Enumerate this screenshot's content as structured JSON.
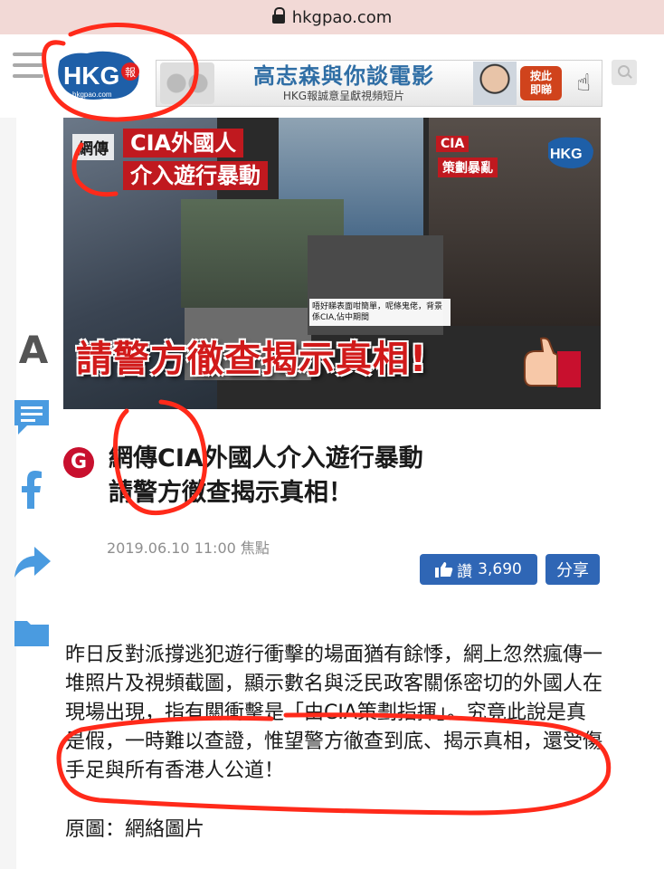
{
  "browser": {
    "url": "hkgpao.com"
  },
  "header": {
    "logo_text": "HKG",
    "logo_sub": "報",
    "logo_domain": "hkgpao.com",
    "banner": {
      "title": "高志森與你談電影",
      "subtitle": "HKG報誠意呈獻視頻短片",
      "cta_line1": "按此",
      "cta_line2": "即睇"
    }
  },
  "hero": {
    "headline_left": "網傳",
    "headline_top": "CIA外國人",
    "headline_bottom": "介入遊行暴動",
    "cia_tag": "CIA",
    "cia_sub": "策劃暴亂",
    "caption": "唔好睇表面咁簡單，呢條鬼佬，背景係CIA,佔中期間",
    "bottom_text": "請警方徹查揭示真相!"
  },
  "article": {
    "badge": "G",
    "title_line1": "網傳CIA外國人介入遊行暴動",
    "title_line2": "請警方徹查揭示真相！",
    "meta": "2019.06.10 11:00 焦點",
    "like_label": "讚",
    "like_count": "3,690",
    "share_label": "分享",
    "body": "昨日反對派撐逃犯遊行衝擊的場面猶有餘悸，網上忽然瘋傳一堆照片及視頻截圖，顯示數名與泛民政客關係密切的外國人在現場出現，指有關衝擊是「由CIA策劃指揮」。究竟此說是真是假，一時難以查證，惟望警方徹查到底、揭示真相，還受傷手足與所有香港人公道！",
    "source": "原圖：網絡圖片"
  },
  "float_bar": {
    "font_size_label": "A"
  },
  "colors": {
    "accent": "#2f66b5",
    "brand_red": "#c8102e",
    "annotation_red": "#ff2a1a"
  }
}
